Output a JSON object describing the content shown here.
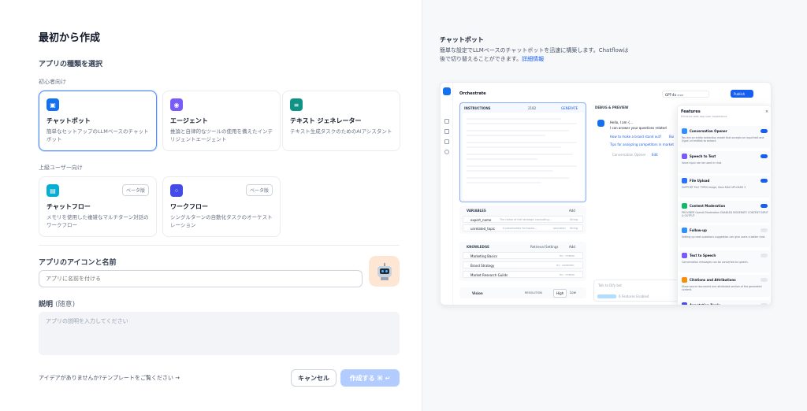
{
  "page": {
    "title": "最初から作成",
    "app_type_label": "アプリの種類を選択",
    "beginner_label": "初心者向け",
    "advanced_label": "上級ユーザー向け",
    "icon_name_label": "アプリのアイコンと名前",
    "name_placeholder": "アプリに名前を付ける",
    "desc_label": "説明",
    "desc_optional": "(随意)",
    "desc_placeholder": "アプリの説明を入力してください",
    "template_link": "アイデアがありませんか?テンプレートをご覧ください →",
    "cancel": "キャンセル",
    "create": "作成する ⌘ ↵"
  },
  "cards": {
    "chatbot": {
      "title": "チャットボット",
      "desc": "簡単なセットアップのLLMベースのチャットボット"
    },
    "agent": {
      "title": "エージェント",
      "desc": "推論と自律的なツールの使用を備えたインテリジェントエージェント"
    },
    "textgen": {
      "title": "テキスト ジェネレーター",
      "desc": "テキスト生成タスクのためのAIアシスタント"
    },
    "chatflow": {
      "title": "チャットフロー",
      "desc": "メモリを使用した複雑なマルチターン対話のワークフロー",
      "badge": "ベータ版"
    },
    "workflow": {
      "title": "ワークフロー",
      "desc": "シングルターンの自動化タスクのオーケストレーション",
      "badge": "ベータ版"
    }
  },
  "right": {
    "title": "チャットボット",
    "desc": "簡単な設定でLLMベースのチャットボットを迅速に構築します。Chatflowは後で切り替えることができます。",
    "more": "詳細情報"
  },
  "preview": {
    "orchestrate": "Orchestrate",
    "model": "GPT-4o",
    "model_tag": "CHAT",
    "publish": "Publish",
    "instructions": "INSTRUCTIONS",
    "instr_count": "2182",
    "generate": "GENERATE",
    "debug": "DEBUG & PREVIEW",
    "greeting": "Hello, I am {...",
    "greeting2": "I can answer your questions related",
    "q1": "How to make a brand stand out?",
    "q1_tail": "Bui",
    "q2": "Tips for analyzing competitors in market",
    "opener": "Conversation Opener",
    "edit": "Edit",
    "variables": "VARIABLES",
    "add": "Add",
    "vars": [
      {
        "name": "expert_name",
        "desc": "The name of the strategic consulting...",
        "type": "String"
      },
      {
        "name": "unrelated_topic",
        "desc": "A placeholder for topics...",
        "req": "REQUIRED",
        "type": "String"
      }
    ],
    "knowledge": "KNOWLEDGE",
    "retrieval": "Retrieval Settings",
    "docs": [
      {
        "name": "Marketing Basics",
        "tag": "HQ · HYBRID"
      },
      {
        "name": "Brand Strategy",
        "tag": "HQ · INVERTED"
      },
      {
        "name": "Market Research Guilds",
        "tag": "HQ · HYBRID"
      }
    ],
    "vision": "Vision",
    "resolution": "RESOLUTION",
    "high": "High",
    "low": "Low",
    "talk": "Talk to Dify bot",
    "features_enabled": "6 Features Enabled",
    "features": "Features",
    "features_sub": "Enhance web app user experience",
    "feature_list": [
      {
        "name": "Conversation Opener",
        "desc": "You are an entity extraction model that accepts an input text and (type) of entities to extract.",
        "on": true,
        "color": "#2e90fa"
      },
      {
        "name": "Speech to Text",
        "desc": "Voice input can be used in chat.",
        "on": true,
        "color": "#7a5af8"
      },
      {
        "name": "File Upload",
        "desc": "SUPPORT FILE TYPES  Image, Docs   MAX UPLOADS 3",
        "on": true,
        "color": "#2970ff"
      },
      {
        "name": "Content Moderation",
        "desc": "PROVIDER OpenAI Moderation   ENABLED MODERATE CONTENT INPUT & OUTPUT",
        "on": true,
        "color": "#12b76a"
      },
      {
        "name": "Follow-up",
        "desc": "Setting up next questions suggestion can give users a better chat.",
        "on": false,
        "color": "#2e90fa"
      },
      {
        "name": "Text to Speech",
        "desc": "Conversation messages can be converted to speech.",
        "on": false,
        "color": "#7a5af8"
      },
      {
        "name": "Citations and Attributions",
        "desc": "Show source document and attributed section of the generated content.",
        "on": false,
        "color": "#f79009"
      },
      {
        "name": "Annotation Reply",
        "desc": "",
        "on": false,
        "color": "#444ce7"
      }
    ]
  }
}
